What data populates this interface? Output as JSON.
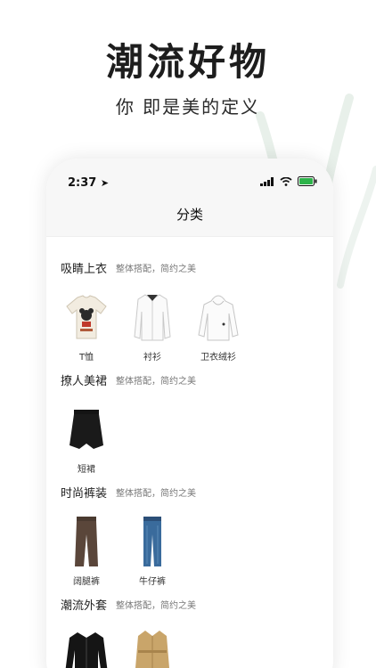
{
  "hero": {
    "title": "潮流好物",
    "subtitle": "你 即是美的定义"
  },
  "status_bar": {
    "time": "2:37"
  },
  "nav": {
    "title": "分类"
  },
  "sections": [
    {
      "title": "吸睛上衣",
      "subtitle": "整体搭配，简约之美",
      "items": [
        {
          "label": "T恤",
          "icon": "tshirt-icon"
        },
        {
          "label": "衬衫",
          "icon": "shirt-icon"
        },
        {
          "label": "卫衣绒衫",
          "icon": "hoodie-icon"
        }
      ]
    },
    {
      "title": "撩人美裙",
      "subtitle": "整体搭配，简约之美",
      "items": [
        {
          "label": "短裙",
          "icon": "skirt-icon"
        }
      ]
    },
    {
      "title": "时尚裤装",
      "subtitle": "整体搭配，简约之美",
      "items": [
        {
          "label": "阔腿裤",
          "icon": "wide-pants-icon"
        },
        {
          "label": "牛仔裤",
          "icon": "jeans-icon"
        }
      ]
    },
    {
      "title": "潮流外套",
      "subtitle": "整体搭配，简约之美",
      "items": [
        {
          "label": "",
          "icon": "jacket-icon"
        },
        {
          "label": "",
          "icon": "trench-coat-icon"
        }
      ]
    }
  ],
  "colors": {
    "accent_green": "#2db34a",
    "background": "#ffffff",
    "nav_bg": "#f7f7f7"
  }
}
